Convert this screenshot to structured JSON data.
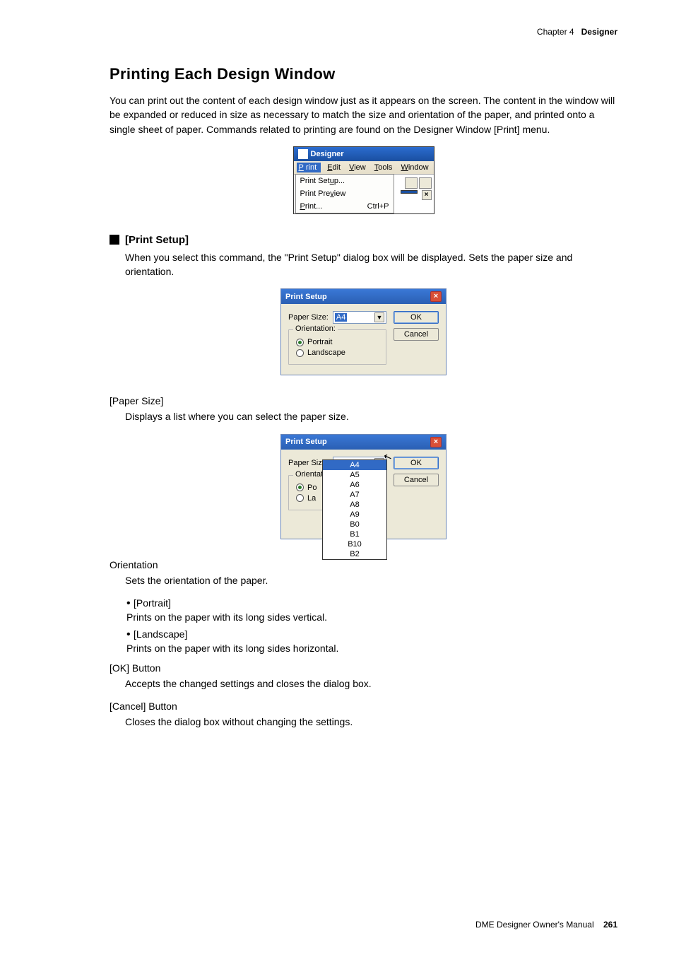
{
  "header": {
    "chapter": "Chapter 4",
    "section": "Designer"
  },
  "title": "Printing Each Design Window",
  "intro": "You can print out the content of each design window just as it appears on the screen. The content in the window will be expanded or reduced in size as necessary to match the size and orientation of the paper, and printed onto a single sheet of paper. Commands related to printing are found on the Designer Window [Print] menu.",
  "designer": {
    "title": "Designer",
    "menus": {
      "print": "Print",
      "edit": "Edit",
      "view": "View",
      "tools": "Tools",
      "window": "Window"
    },
    "dropdown": {
      "setup": "Print Setup...",
      "preview": "Print Preview",
      "print": "Print...",
      "print_shortcut": "Ctrl+P"
    }
  },
  "print_setup_section": {
    "heading": "[Print Setup]",
    "desc": "When you select this command, the \"Print Setup\" dialog box will be displayed. Sets the paper size and orientation."
  },
  "dlg1": {
    "title": "Print Setup",
    "paper_label": "Paper Size:",
    "paper_value": "A4",
    "orientation_legend": "Orientation:",
    "portrait": "Portrait",
    "landscape": "Landscape",
    "ok": "OK",
    "cancel": "Cancel"
  },
  "paper_size": {
    "heading": "[Paper Size]",
    "desc": "Displays a list where you can select the paper size."
  },
  "dlg2": {
    "title": "Print Setup",
    "paper_label": "Paper Size:",
    "paper_value": "A4",
    "orientation_legend": "Orientation:",
    "portrait_short": "Po",
    "landscape_short": "La",
    "ok": "OK",
    "cancel": "Cancel",
    "options": [
      "A4",
      "A5",
      "A6",
      "A7",
      "A8",
      "A9",
      "B0",
      "B1",
      "B10",
      "B2"
    ]
  },
  "orientation": {
    "heading": "Orientation",
    "desc": "Sets the orientation of the paper.",
    "portrait_label": "[Portrait]",
    "portrait_desc": "Prints on the paper with its long sides vertical.",
    "landscape_label": "[Landscape]",
    "landscape_desc": "Prints on the paper with its long sides horizontal."
  },
  "ok_btn": {
    "heading": "[OK] Button",
    "desc": "Accepts the changed settings and closes the dialog box."
  },
  "cancel_btn": {
    "heading": "[Cancel] Button",
    "desc": "Closes the dialog box without changing the settings."
  },
  "footer": {
    "manual": "DME Designer Owner's Manual",
    "page": "261"
  }
}
